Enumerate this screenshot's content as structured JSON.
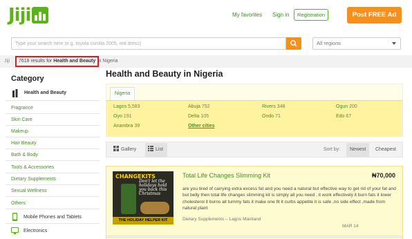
{
  "header": {
    "logo_text": "Jiji",
    "my_favorites": "My favorites",
    "sign_in": "Sign in",
    "registration": "Registration",
    "post_ad": "Post FREE Ad",
    "brand_color": "#5bb318",
    "accent_color": "#f4911e"
  },
  "search": {
    "placeholder": "Type your search here (e.g. toyota corolla 2005, red dress)",
    "region": "All regions"
  },
  "breadcrumb": {
    "home": "Jiji",
    "count": "7618",
    "count_text": " results for ",
    "category": "Health and Beauty",
    "tail": "in Nigeria"
  },
  "sidebar": {
    "title": "Category",
    "active": "Health and Beauty",
    "subcategories": [
      "Fragrance",
      "Skin Care",
      "Makeup",
      "Hair Beauty",
      "Bath & Body",
      "Tools & Accessories",
      "Dietary Supplements",
      "Sexual Wellness",
      "Others"
    ],
    "other_categories": [
      {
        "label": "Mobile Phones and Tablets",
        "icon": "phone-icon"
      },
      {
        "label": "Electronics",
        "icon": "monitor-icon"
      }
    ]
  },
  "main": {
    "title": "Health and Beauty in Nigeria",
    "country_tab": "Nigeria",
    "cities": [
      {
        "name": "Lagos",
        "count": "5,583"
      },
      {
        "name": "Abuja",
        "count": "752"
      },
      {
        "name": "Rivers",
        "count": "348"
      },
      {
        "name": "Ogun",
        "count": "200"
      },
      {
        "name": "Oyo",
        "count": "191"
      },
      {
        "name": "Delta",
        "count": "105"
      },
      {
        "name": "Ondo",
        "count": "71"
      },
      {
        "name": "Edo",
        "count": "67"
      },
      {
        "name": "Anambra",
        "count": "39"
      }
    ],
    "other_cities": "Other cities",
    "toolbar": {
      "gallery": "Gallery",
      "list": "List",
      "sort_by": "Sort by:",
      "newest": "Newest",
      "cheapest": "Cheapest"
    }
  },
  "listing": {
    "title": "Total Life Changes Slimming Kit",
    "price": "₦70,000",
    "description": "are you tired of carrying extra excess fat and you need a natural but effective way to get rid of your fat and but belly then total life changes slimming kit is simply all you need , it work effectively it burn fats it lower cholesterol it burns all tummy fats it make one fit it curbs appetite it is safe ,no side effect ,made from natural plant",
    "category": "Dietary Supplements",
    "location": "Lagos Mainland",
    "date": "MAR 14",
    "thumb_headline": "CHANGEKITS",
    "thumb_tagline": "Don't let the holidays hold you back this Christmas",
    "thumb_footer": "THE HOLIDAY HELPER KIT"
  }
}
